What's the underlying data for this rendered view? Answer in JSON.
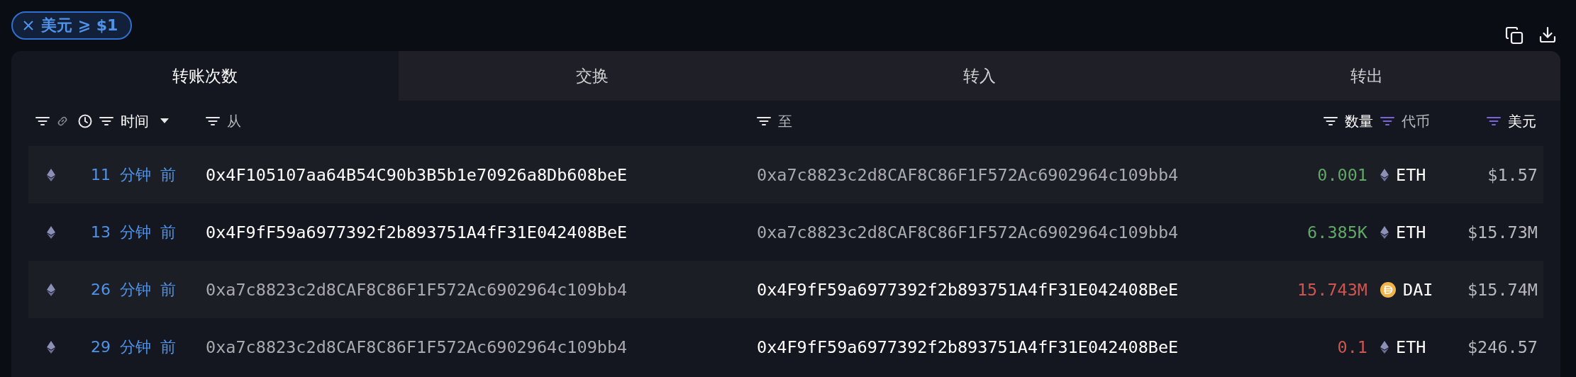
{
  "filter_chip": {
    "label": "美元 ⩾ $1"
  },
  "tabs": [
    {
      "label": "转账次数",
      "selected": true
    },
    {
      "label": "交换",
      "selected": false
    },
    {
      "label": "转入",
      "selected": false
    },
    {
      "label": "转出",
      "selected": false
    }
  ],
  "columns": [
    {
      "label": "时间",
      "filter_active": false,
      "highlighted": true,
      "kind": "time"
    },
    {
      "label": "从",
      "filter_active": false,
      "highlighted": false,
      "kind": "from"
    },
    {
      "label": "至",
      "filter_active": false,
      "highlighted": false,
      "kind": "to"
    },
    {
      "label": "数量",
      "filter_active": false,
      "highlighted": true,
      "kind": "amount"
    },
    {
      "label": "代币",
      "filter_active": true,
      "highlighted": false,
      "kind": "token"
    },
    {
      "label": "美元",
      "filter_active": true,
      "highlighted": true,
      "kind": "usd"
    }
  ],
  "rows": [
    {
      "time": "11 分钟 前",
      "from": {
        "address": "0x4F105107aa64B54C90b3B5b1e70926a8Db608beE",
        "highlighted": true
      },
      "to": {
        "address": "0xa7c8823c2d8CAF8C86F1F572Ac6902964c109bb4",
        "highlighted": false
      },
      "amount": {
        "text": "0.001",
        "kind": "in"
      },
      "token": {
        "symbol": "ETH",
        "kind": "eth"
      },
      "usd": "$1.57"
    },
    {
      "time": "13 分钟 前",
      "from": {
        "address": "0x4F9fF59a6977392f2b893751A4fF31E042408BeE",
        "highlighted": true
      },
      "to": {
        "address": "0xa7c8823c2d8CAF8C86F1F572Ac6902964c109bb4",
        "highlighted": false
      },
      "amount": {
        "text": "6.385K",
        "kind": "in"
      },
      "token": {
        "symbol": "ETH",
        "kind": "eth"
      },
      "usd": "$15.73M"
    },
    {
      "time": "26 分钟 前",
      "from": {
        "address": "0xa7c8823c2d8CAF8C86F1F572Ac6902964c109bb4",
        "highlighted": false
      },
      "to": {
        "address": "0x4F9fF59a6977392f2b893751A4fF31E042408BeE",
        "highlighted": true
      },
      "amount": {
        "text": "15.743M",
        "kind": "out"
      },
      "token": {
        "symbol": "DAI",
        "kind": "dai"
      },
      "usd": "$15.74M"
    },
    {
      "time": "29 分钟 前",
      "from": {
        "address": "0xa7c8823c2d8CAF8C86F1F572Ac6902964c109bb4",
        "highlighted": false
      },
      "to": {
        "address": "0x4F9fF59a6977392f2b893751A4fF31E042408BeE",
        "highlighted": true
      },
      "amount": {
        "text": "0.1",
        "kind": "out"
      },
      "token": {
        "symbol": "ETH",
        "kind": "eth"
      },
      "usd": "$246.57"
    }
  ]
}
